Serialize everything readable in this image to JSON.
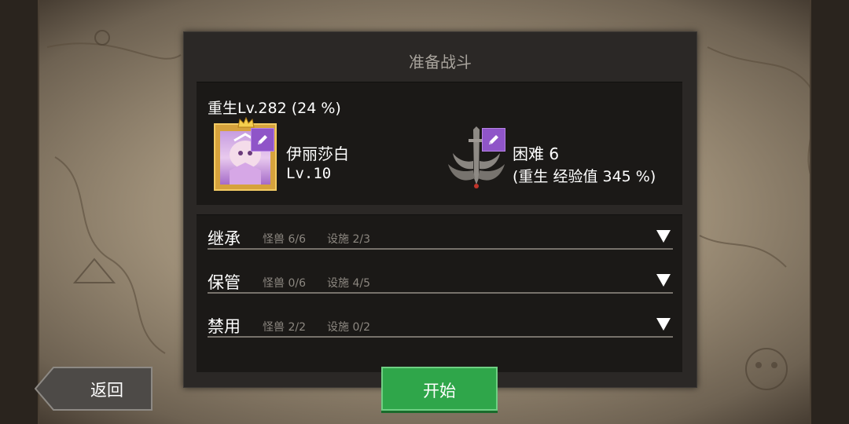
{
  "dialog": {
    "title": "准备战斗"
  },
  "party": {
    "rebirth": "重生Lv.282 (24 %)",
    "hero_name": "伊丽莎白",
    "hero_level": "Lv.10",
    "difficulty": "困难 6",
    "difficulty_bonus": "(重生 经验值 345 %)"
  },
  "sections": [
    {
      "title": "继承",
      "monsters": "怪兽 6/6",
      "facilities": "设施 2/3"
    },
    {
      "title": "保管",
      "monsters": "怪兽 0/6",
      "facilities": "设施 4/5"
    },
    {
      "title": "禁用",
      "monsters": "怪兽 2/2",
      "facilities": "设施 0/2"
    }
  ],
  "buttons": {
    "back": "返回",
    "start": "开始"
  },
  "colors": {
    "accent_purple": "#8f55c8",
    "start_green": "#2fa64a",
    "hero_frame_gold": "#d6a23c"
  },
  "icons": {
    "edit": "pencil-icon",
    "expand": "triangle-down-icon",
    "difficulty": "sword-wings-icon"
  }
}
